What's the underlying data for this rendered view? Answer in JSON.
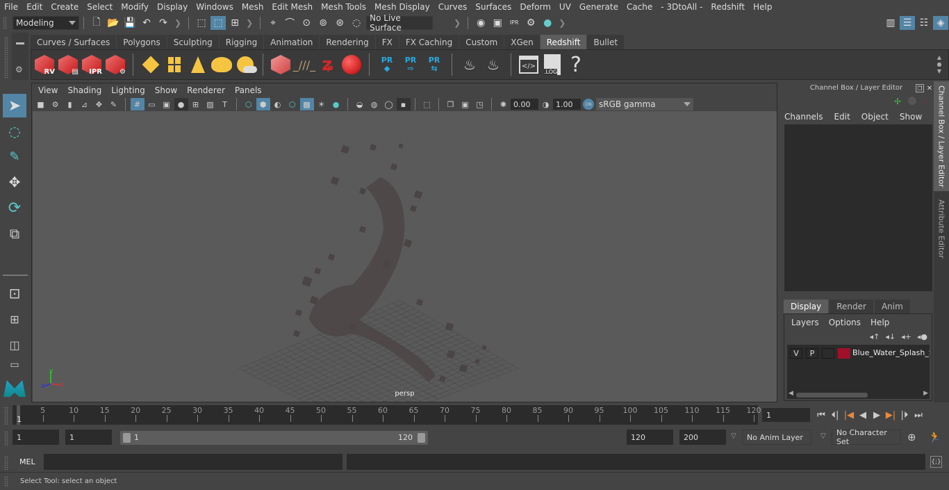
{
  "menubar": [
    "File",
    "Edit",
    "Create",
    "Select",
    "Modify",
    "Display",
    "Windows",
    "Mesh",
    "Edit Mesh",
    "Mesh Tools",
    "Mesh Display",
    "Curves",
    "Surfaces",
    "Deform",
    "UV",
    "Generate",
    "Cache",
    "- 3DtoAll -",
    "Redshift",
    "Help"
  ],
  "toolbar": {
    "mode": "Modeling",
    "live_surface": "No Live Surface"
  },
  "shelf": {
    "tabs": [
      "Curves / Surfaces",
      "Polygons",
      "Sculpting",
      "Rigging",
      "Animation",
      "Rendering",
      "FX",
      "FX Caching",
      "Custom",
      "XGen",
      "Redshift",
      "Bullet"
    ],
    "active_tab": "Redshift",
    "icons": [
      {
        "name": "redshift-renderview-icon",
        "label": "RV"
      },
      {
        "name": "redshift-batch-render-icon",
        "label": ""
      },
      {
        "name": "redshift-ipr-icon",
        "label": "IPR"
      },
      {
        "name": "redshift-render-settings-icon",
        "label": ""
      },
      {
        "name": "area-light-icon",
        "label": ""
      },
      {
        "name": "portal-light-icon",
        "label": ""
      },
      {
        "name": "spot-light-icon",
        "label": ""
      },
      {
        "name": "dome-light-icon",
        "label": ""
      },
      {
        "name": "sun-sky-icon",
        "label": ""
      },
      {
        "name": "proxy-cube-icon",
        "label": ""
      },
      {
        "name": "hair-icon",
        "label": ""
      },
      {
        "name": "volume-icon",
        "label": ""
      },
      {
        "name": "sphere-material-icon",
        "label": ""
      },
      {
        "name": "pr-proxy-icon",
        "label": "PR"
      },
      {
        "name": "pr-export-icon",
        "label": "PR"
      },
      {
        "name": "pr-convert-icon",
        "label": "PR"
      },
      {
        "name": "bake-icon",
        "label": ""
      },
      {
        "name": "bake-single-icon",
        "label": ""
      },
      {
        "name": "script-icon",
        "label": ""
      },
      {
        "name": "log-icon",
        "label": ".LOG"
      },
      {
        "name": "help-icon",
        "label": "?"
      }
    ]
  },
  "viewport": {
    "menu": [
      "View",
      "Shading",
      "Lighting",
      "Show",
      "Renderer",
      "Panels"
    ],
    "exposure": "0.00",
    "gamma": "1.00",
    "color_space": "sRGB gamma",
    "camera_label": "persp",
    "axis": {
      "x": "x",
      "y": "y",
      "z": "z"
    }
  },
  "channel_box": {
    "title": "Channel Box / Layer Editor",
    "menu": [
      "Channels",
      "Edit",
      "Object",
      "Show"
    ]
  },
  "layer_editor": {
    "tabs": [
      "Display",
      "Render",
      "Anim"
    ],
    "active_tab": "Display",
    "menu": [
      "Layers",
      "Options",
      "Help"
    ],
    "layers": [
      {
        "v": "V",
        "p": "P",
        "color": "#a0102a",
        "name": "Blue_Water_Splash_Sp"
      }
    ]
  },
  "side_tabs": [
    "Channel Box / Layer Editor",
    "Attribute Editor"
  ],
  "timeslider": {
    "ticks": [
      5,
      10,
      15,
      20,
      25,
      30,
      35,
      40,
      45,
      50,
      55,
      60,
      65,
      70,
      75,
      80,
      85,
      90,
      95,
      100,
      105,
      110,
      115,
      120
    ],
    "start": 1,
    "end": 120,
    "current_frame_marker": "1",
    "current_frame": "1"
  },
  "range": {
    "start_time": "1",
    "playback_start": "1",
    "range_start_label": "1",
    "range_end_label": "120",
    "playback_end": "120",
    "end_time": "200",
    "anim_layer": "No Anim Layer",
    "character_set": "No Character Set"
  },
  "command_line": {
    "language": "MEL",
    "value": ""
  },
  "help_line": "Select Tool: select an object"
}
